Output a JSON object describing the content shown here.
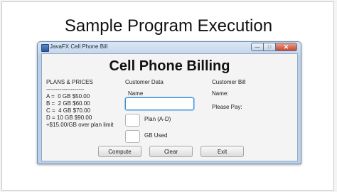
{
  "slide": {
    "title": "Sample Program Execution"
  },
  "window": {
    "title": "JavaFX Cell Phone Bill",
    "controls": {
      "minimize": "—",
      "maximize": "□",
      "close": "✕"
    }
  },
  "app": {
    "heading": "Cell Phone Billing",
    "plans": {
      "header": "PLANS & PRICES",
      "divider": "--------------------",
      "items": [
        "A =  0 GB $50.00",
        "B =  2 GB $60.00",
        "C =  4 GB $70.00",
        "D = 10 GB $90.00",
        "+$15.00/GB over plan limit"
      ]
    },
    "customer_data": {
      "header": "Customer Data",
      "name_label": "Name",
      "name_value": "",
      "plan_label": "Plan  (A-D)",
      "plan_value": "",
      "gb_label": "GB Used",
      "gb_value": ""
    },
    "customer_bill": {
      "header": "Customer Bill",
      "name_label": "Name:",
      "pay_label": "Please Pay:"
    },
    "buttons": {
      "compute": "Compute",
      "clear": "Clear",
      "exit": "Exit"
    }
  }
}
